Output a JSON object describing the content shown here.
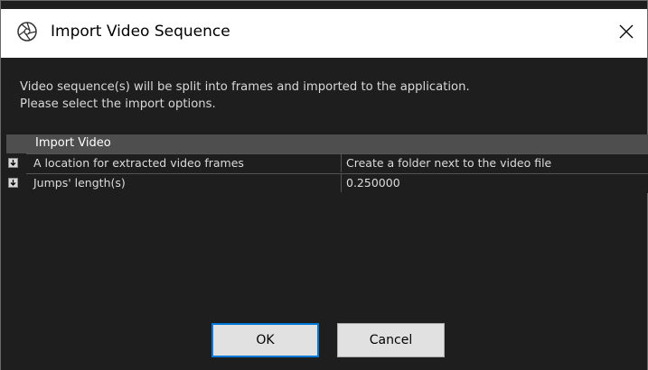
{
  "window": {
    "title": "Import Video Sequence",
    "title_icon": "aperture-icon",
    "close_icon": "close-icon"
  },
  "description": {
    "line1": "Video sequence(s) will be split into frames and imported to the application.",
    "line2": "Please select the import options."
  },
  "property_grid": {
    "section_header": "Import Video",
    "rows": [
      {
        "key": "A location for extracted video frames",
        "value": "Create a folder next to the video file",
        "expander_icon": "expand-icon"
      },
      {
        "key": "Jumps' length(s)",
        "value": "0.250000",
        "expander_icon": "expand-icon"
      }
    ]
  },
  "buttons": {
    "ok": "OK",
    "cancel": "Cancel"
  },
  "colors": {
    "background": "#1e1e1e",
    "header": "#4e4e4e",
    "ok_border": "#0078d7"
  }
}
